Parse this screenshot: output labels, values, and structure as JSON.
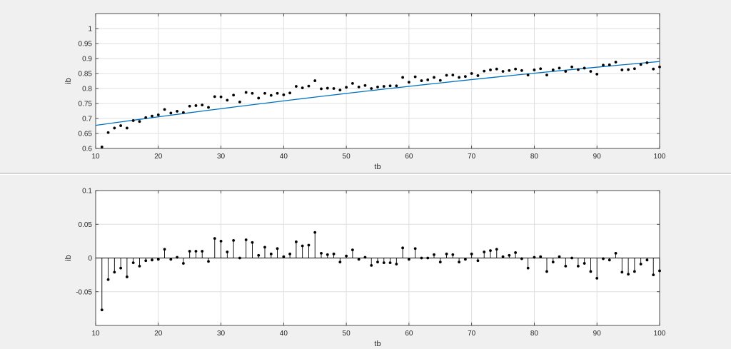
{
  "chart_data": [
    {
      "type": "scatter",
      "title": "",
      "xlabel": "tb",
      "ylabel": "ib",
      "xlim": [
        10,
        100
      ],
      "ylim": [
        0.6,
        1.05
      ],
      "xticks": [
        10,
        20,
        30,
        40,
        50,
        60,
        70,
        80,
        90,
        100
      ],
      "yticks": [
        0.6,
        0.65,
        0.7,
        0.75,
        0.8,
        0.85,
        0.9,
        0.95,
        1
      ],
      "ytick_labels": [
        "0.6",
        "0.65",
        "0.7",
        "0.75",
        "0.8",
        "0.85",
        "0.9",
        "0.95",
        "1"
      ],
      "grid": true,
      "x": [
        11,
        12,
        13,
        14,
        15,
        16,
        17,
        18,
        19,
        20,
        21,
        22,
        23,
        24,
        25,
        26,
        27,
        28,
        29,
        30,
        31,
        32,
        33,
        34,
        35,
        36,
        37,
        38,
        39,
        40,
        41,
        42,
        43,
        44,
        45,
        46,
        47,
        48,
        49,
        50,
        51,
        52,
        53,
        54,
        55,
        56,
        57,
        58,
        59,
        60,
        61,
        62,
        63,
        64,
        65,
        66,
        67,
        68,
        69,
        70,
        71,
        72,
        73,
        74,
        75,
        76,
        77,
        78,
        79,
        80,
        81,
        82,
        83,
        84,
        85,
        86,
        87,
        88,
        89,
        90,
        91,
        92,
        93,
        94,
        95,
        96,
        97,
        98,
        99,
        100
      ],
      "series": [
        {
          "style": "points",
          "color": "#000000",
          "y": [
            0.605,
            0.653,
            0.668,
            0.676,
            0.668,
            0.693,
            0.69,
            0.703,
            0.708,
            0.712,
            0.73,
            0.718,
            0.724,
            0.72,
            0.741,
            0.743,
            0.745,
            0.737,
            0.773,
            0.772,
            0.761,
            0.778,
            0.755,
            0.787,
            0.784,
            0.768,
            0.784,
            0.777,
            0.784,
            0.779,
            0.785,
            0.807,
            0.802,
            0.808,
            0.826,
            0.799,
            0.801,
            0.8,
            0.795,
            0.804,
            0.817,
            0.805,
            0.81,
            0.8,
            0.805,
            0.807,
            0.809,
            0.809,
            0.837,
            0.821,
            0.839,
            0.826,
            0.829,
            0.837,
            0.827,
            0.844,
            0.845,
            0.837,
            0.84,
            0.85,
            0.843,
            0.858,
            0.862,
            0.865,
            0.857,
            0.86,
            0.865,
            0.86,
            0.845,
            0.862,
            0.866,
            0.845,
            0.862,
            0.868,
            0.857,
            0.872,
            0.863,
            0.868,
            0.857,
            0.848,
            0.878,
            0.879,
            0.888,
            0.862,
            0.863,
            0.866,
            0.88,
            0.886,
            0.865,
            0.872
          ]
        },
        {
          "style": "line",
          "color": "#0072bd",
          "y_fit_at_xlim": [
            0.677,
            0.89
          ]
        }
      ]
    },
    {
      "type": "stem",
      "title": "",
      "xlabel": "tb",
      "ylabel": "ib",
      "xlim": [
        10,
        100
      ],
      "ylim": [
        -0.1,
        0.1
      ],
      "xticks": [
        10,
        20,
        30,
        40,
        50,
        60,
        70,
        80,
        90,
        100
      ],
      "yticks": [
        -0.05,
        0,
        0.05,
        0.1
      ],
      "ytick_labels": [
        "-0.05",
        "0",
        "0.05",
        "0.1"
      ],
      "grid": true,
      "x": [
        11,
        12,
        13,
        14,
        15,
        16,
        17,
        18,
        19,
        20,
        21,
        22,
        23,
        24,
        25,
        26,
        27,
        28,
        29,
        30,
        31,
        32,
        33,
        34,
        35,
        36,
        37,
        38,
        39,
        40,
        41,
        42,
        43,
        44,
        45,
        46,
        47,
        48,
        49,
        50,
        51,
        52,
        53,
        54,
        55,
        56,
        57,
        58,
        59,
        60,
        61,
        62,
        63,
        64,
        65,
        66,
        67,
        68,
        69,
        70,
        71,
        72,
        73,
        74,
        75,
        76,
        77,
        78,
        79,
        80,
        81,
        82,
        83,
        84,
        85,
        86,
        87,
        88,
        89,
        90,
        91,
        92,
        93,
        94,
        95,
        96,
        97,
        98,
        99,
        100
      ],
      "series": [
        {
          "color": "#000000",
          "values": [
            -0.077,
            -0.032,
            -0.021,
            -0.015,
            -0.028,
            -0.007,
            -0.012,
            -0.004,
            -0.003,
            -0.002,
            0.013,
            -0.002,
            0.001,
            -0.008,
            0.01,
            0.01,
            0.01,
            -0.005,
            0.029,
            0.025,
            0.009,
            0.026,
            0.0,
            0.027,
            0.023,
            0.004,
            0.016,
            0.006,
            0.014,
            0.002,
            0.006,
            0.024,
            0.018,
            0.019,
            0.038,
            0.007,
            0.005,
            0.006,
            -0.006,
            0.003,
            0.012,
            -0.002,
            0.001,
            -0.011,
            -0.006,
            -0.007,
            -0.007,
            -0.009,
            0.015,
            -0.002,
            0.014,
            0.0,
            0.0,
            0.005,
            -0.006,
            0.006,
            0.005,
            -0.006,
            -0.002,
            0.006,
            -0.004,
            0.009,
            0.011,
            0.013,
            0.002,
            0.004,
            0.008,
            -0.001,
            -0.015,
            0.001,
            0.002,
            -0.02,
            -0.006,
            0.002,
            -0.012,
            0.0,
            -0.012,
            -0.008,
            -0.02,
            -0.03,
            -0.001,
            -0.003,
            0.007,
            -0.021,
            -0.024,
            -0.02,
            -0.009,
            -0.003,
            -0.025,
            -0.019
          ]
        }
      ]
    }
  ]
}
